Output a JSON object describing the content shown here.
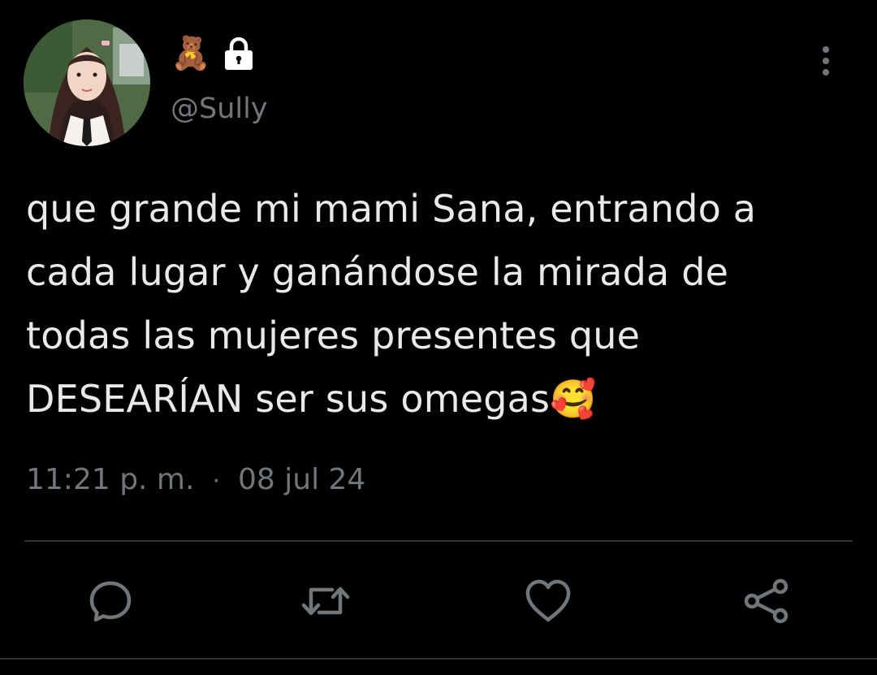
{
  "tweet": {
    "name_emojis": [
      "🧸"
    ],
    "handle": "@Sully",
    "text_lines": [
      "que grande mi mami Sana, entrando a",
      "cada lugar y ganándose la mirada de",
      "todas las mujeres presentes que",
      "DESEARÍAN ser sus omegas🥰"
    ],
    "time": "11:21 p. m.",
    "separator": "·",
    "date": "08 jul 24"
  },
  "icons": {
    "bear": "teddy-bear-emoji",
    "lock": "lock-icon",
    "more": "more-vertical-icon",
    "reply": "reply-icon",
    "retweet": "retweet-icon",
    "like": "heart-icon",
    "share": "share-icon"
  },
  "colors": {
    "background": "#000000",
    "text": "#e7e9ea",
    "secondary": "#71767b",
    "divider": "#2f3336"
  }
}
